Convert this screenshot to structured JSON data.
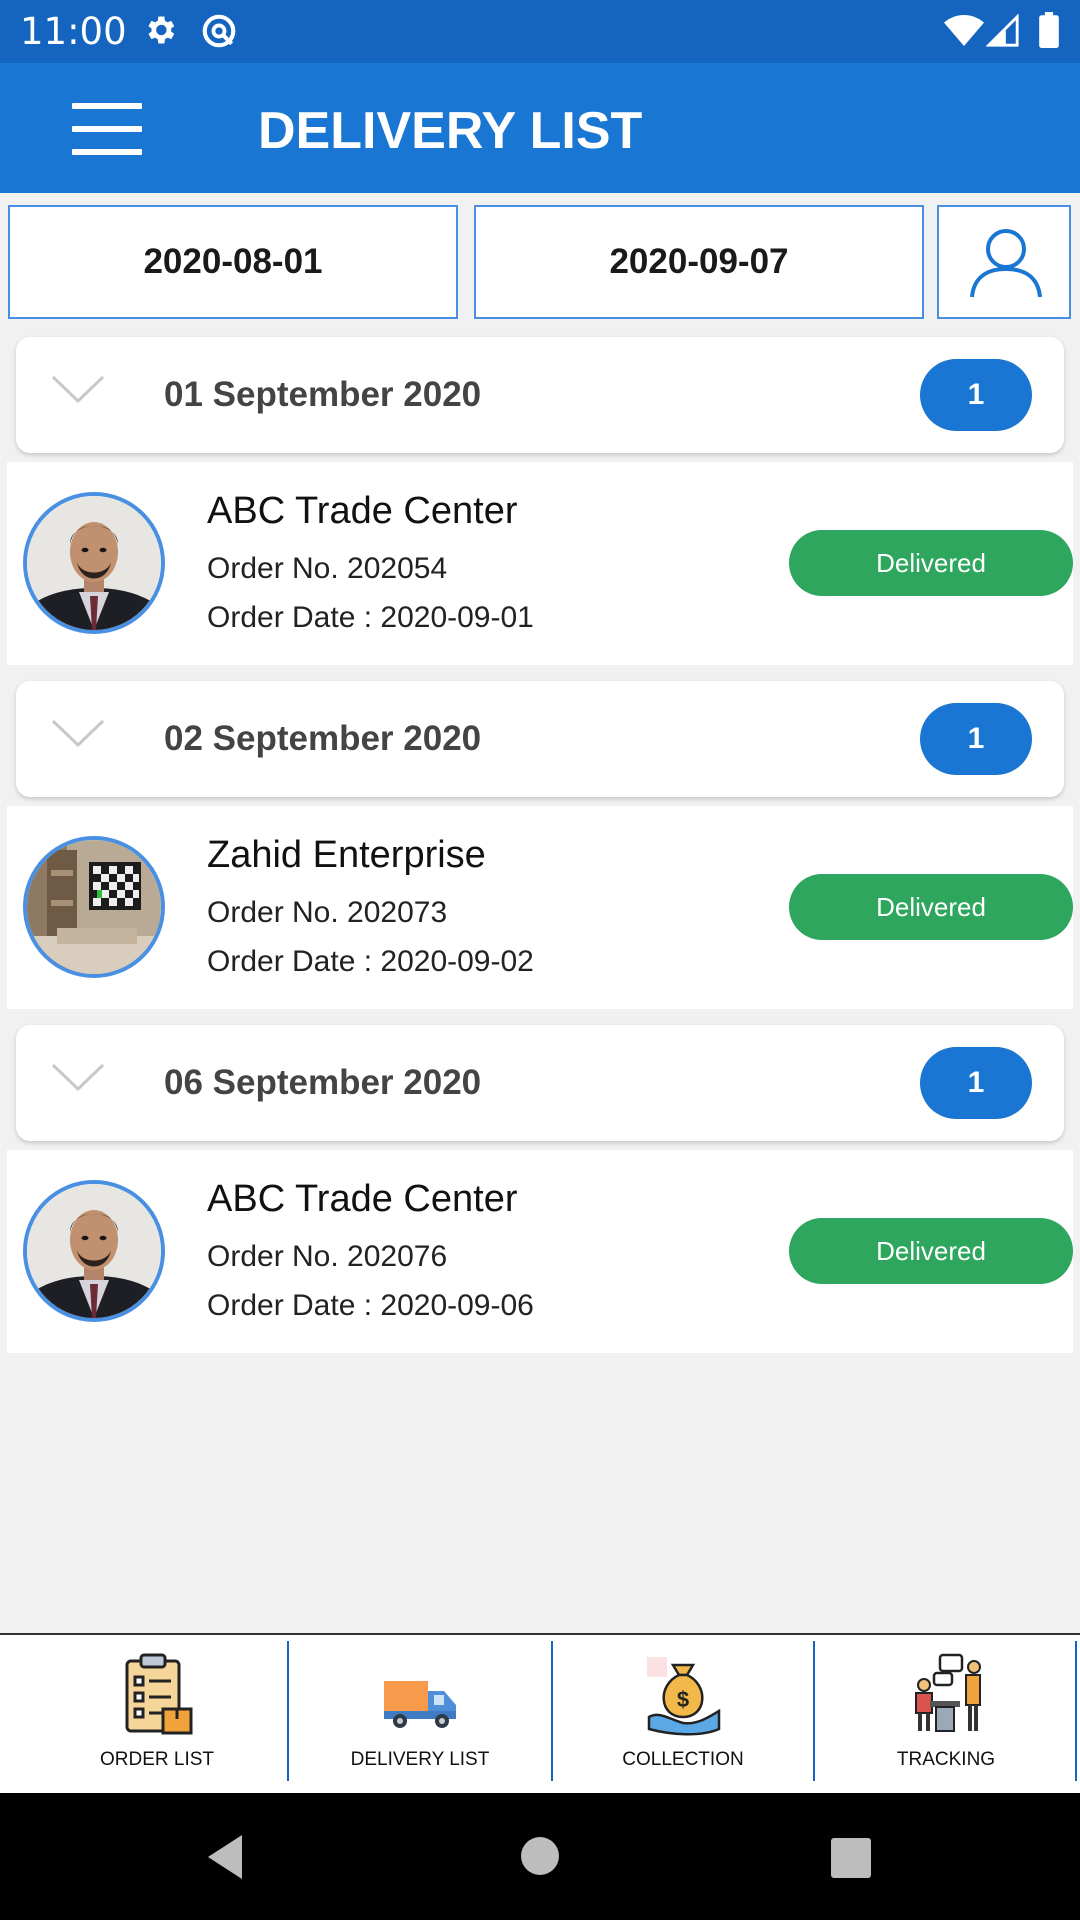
{
  "status_bar": {
    "time": "11:00",
    "icons": [
      "gear-icon",
      "no-location-icon",
      "wifi-icon",
      "signal-icon",
      "battery-icon"
    ]
  },
  "app_bar": {
    "title": "DELIVERY LIST",
    "menu_icon": "hamburger-menu-icon"
  },
  "filters": {
    "from_date": "2020-08-01",
    "to_date": "2020-09-07",
    "profile_icon": "user-icon"
  },
  "groups": [
    {
      "title": "01 September 2020",
      "count": "1",
      "deliveries": [
        {
          "shop": "ABC Trade Center",
          "order_no": "Order No. 202054",
          "order_date": "Order Date : 2020-09-01",
          "status": "Delivered",
          "avatar": "man-portrait-photo"
        }
      ]
    },
    {
      "title": "02 September 2020",
      "count": "1",
      "deliveries": [
        {
          "shop": "Zahid Enterprise",
          "order_no": "Order No. 202073",
          "order_date": "Order Date : 2020-09-02",
          "status": "Delivered",
          "avatar": "room-interior-photo"
        }
      ]
    },
    {
      "title": "06 September 2020",
      "count": "1",
      "deliveries": [
        {
          "shop": "ABC Trade Center",
          "order_no": "Order No. 202076",
          "order_date": "Order Date : 2020-09-06",
          "status": "Delivered",
          "avatar": "man-portrait-photo"
        }
      ]
    }
  ],
  "bottom_nav": [
    {
      "label": "ORDER LIST",
      "icon": "clipboard-list-icon"
    },
    {
      "label": "DELIVERY LIST",
      "icon": "delivery-truck-icon"
    },
    {
      "label": "COLLECTION",
      "icon": "money-bag-hand-icon"
    },
    {
      "label": "TRACKING",
      "icon": "tracking-people-icon"
    }
  ],
  "colors": {
    "status_bar": "#1565c0",
    "app_bar": "#1976d2",
    "badge": "#1976d2",
    "delivered": "#2ea65d",
    "outline": "#4a90e2"
  }
}
